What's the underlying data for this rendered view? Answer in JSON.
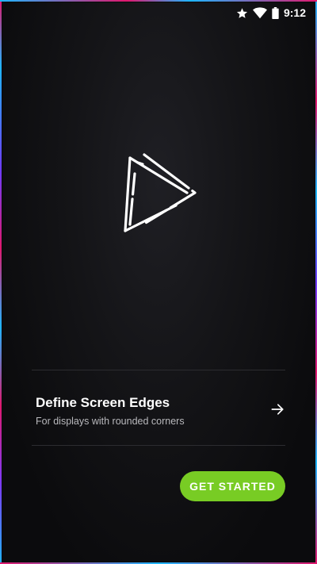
{
  "status_bar": {
    "time": "9:12",
    "icons": [
      "star-icon",
      "wifi-icon",
      "battery-icon"
    ]
  },
  "logo": {
    "icon": "play-triangle-logo"
  },
  "option": {
    "title": "Define Screen Edges",
    "subtitle": "For displays with rounded corners",
    "icon": "arrow-right-icon"
  },
  "actions": {
    "get_started_label": "GET STARTED"
  },
  "colors": {
    "background": "#0b0b0d",
    "accent_button": "#78cc24",
    "edge_pink": "#e0186e",
    "edge_blue": "#1fb6ff",
    "text_primary": "#ffffff",
    "text_secondary": "#b9b9bd"
  }
}
